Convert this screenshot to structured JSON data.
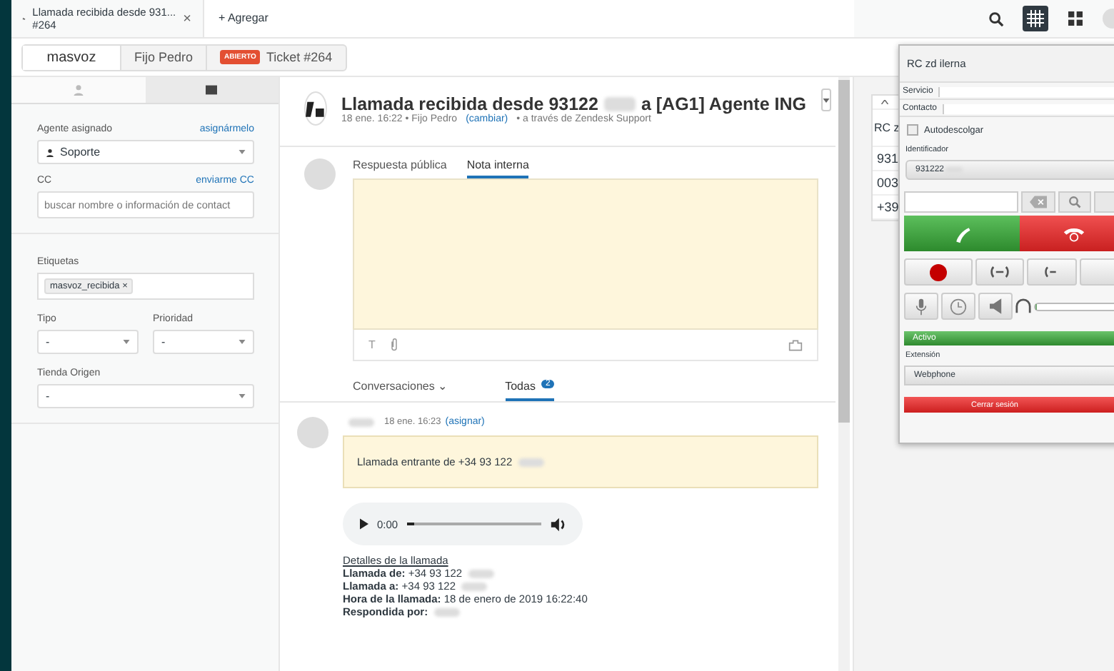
{
  "tab": {
    "title": "Llamada recibida desde 931...",
    "subtitle": "#264",
    "close": "×"
  },
  "add_tab": "+ Agregar",
  "top_icons": [
    {
      "kind": "search",
      "selected": false
    },
    {
      "kind": "grid",
      "selected": true
    },
    {
      "kind": "apps",
      "selected": false
    }
  ],
  "breadcrumbs": [
    {
      "label": "masvoz"
    },
    {
      "label": "Fijo Pedro"
    },
    {
      "badge": "ABIERTO",
      "label": "Ticket #264"
    }
  ],
  "sidebar": {
    "tabs": [
      {
        "kind": "user",
        "selected": false
      },
      {
        "kind": "ticket",
        "selected": true
      }
    ],
    "assignee": {
      "label": "Agente asignado",
      "link": "asignármelo",
      "value": "Soporte"
    },
    "cc": {
      "label": "CC",
      "link": "enviarme CC",
      "placeholder": "buscar nombre o información de contact"
    },
    "tags": {
      "label": "Etiquetas",
      "items": [
        "masvoz_recibida ×"
      ]
    },
    "selects": [
      {
        "label": "Tipo",
        "value": "-"
      },
      {
        "label": "Prioridad",
        "value": "-"
      }
    ],
    "store": {
      "label": "Tienda Origen",
      "value": "-"
    }
  },
  "ticket": {
    "title_start": "Llamada recibida desde 93122",
    "title_end": "a [AG1] Agente ING",
    "meta": "18 ene. 16:22 • Fijo Pedro",
    "change": "(cambiar)",
    "via": "• a través de Zendesk Support"
  },
  "composer": {
    "format": "T",
    "tabs": [
      {
        "label": "Respuesta pública",
        "selected": false
      },
      {
        "label": "Nota interna",
        "selected": true
      }
    ]
  },
  "conversation_tabs": [
    {
      "label": "Conversaciones ⌄",
      "selected": false
    },
    {
      "label": "Todas",
      "count": "2",
      "selected": true
    }
  ],
  "message": {
    "time": "18 ene. 16:23",
    "assign": "(asignar)",
    "note": "Llamada entrante de +34 93 122",
    "audio_time": "0:00",
    "details_title": "Detalles de la llamada",
    "details": [
      {
        "text": "**Llamada de:** +34 93 122",
        "blurred": true
      },
      {
        "text": "**Llamada a:** +34 93 122",
        "blurred": true
      },
      {
        "text": "**Hora de la llamada:** 18 de enero de 2019 16:22:40",
        "blurred": false
      },
      {
        "text": "**Respondida por:**",
        "blurred": true
      }
    ]
  },
  "app_card": {
    "title": "RC z",
    "rows": [
      "931",
      "003",
      "+39"
    ]
  },
  "phone": {
    "title": "RC zd ilerna",
    "fields": [
      {
        "label": "Servicio"
      },
      {
        "label": "Contacto"
      }
    ],
    "autoanswer": {
      "label": "Autodescolgar",
      "checked": false
    },
    "id_label": "Identificador",
    "id_value": "931222",
    "status": "Activo",
    "ext_label": "Extensión",
    "extension": "Webphone",
    "logout": "Cerrar sesión",
    "volume": {
      "level": 0
    }
  }
}
